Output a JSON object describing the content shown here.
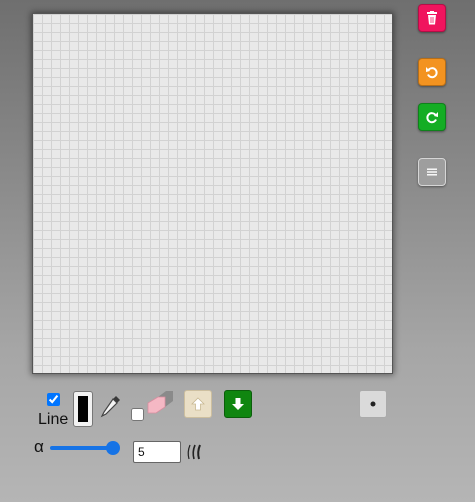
{
  "toolbar": {
    "clear_icon": "trash-icon",
    "undo_icon": "undo-icon",
    "redo_icon": "redo-icon",
    "menu_icon": "menu-icon",
    "colors": {
      "clear": "#f0145e",
      "undo": "#f39320",
      "redo": "#14ad24",
      "menu": "#9e9e9e"
    }
  },
  "canvas": {
    "background": "#e9e9e9",
    "grid_color": "#d2d2d2"
  },
  "controls": {
    "line_checkbox_checked": true,
    "line_label": "Line",
    "stroke_color": "#000000",
    "eyedropper_icon": "eyedropper-icon",
    "fill_checkbox_checked": false,
    "eraser_icon": "eraser-icon",
    "move_up_icon": "arrow-up-icon",
    "move_down_icon": "arrow-down-icon",
    "dot_icon": "dot-icon",
    "alpha_label": "α",
    "alpha_value": 1.0,
    "width_value": "5",
    "brush_icon": "brush-strokes-icon"
  }
}
